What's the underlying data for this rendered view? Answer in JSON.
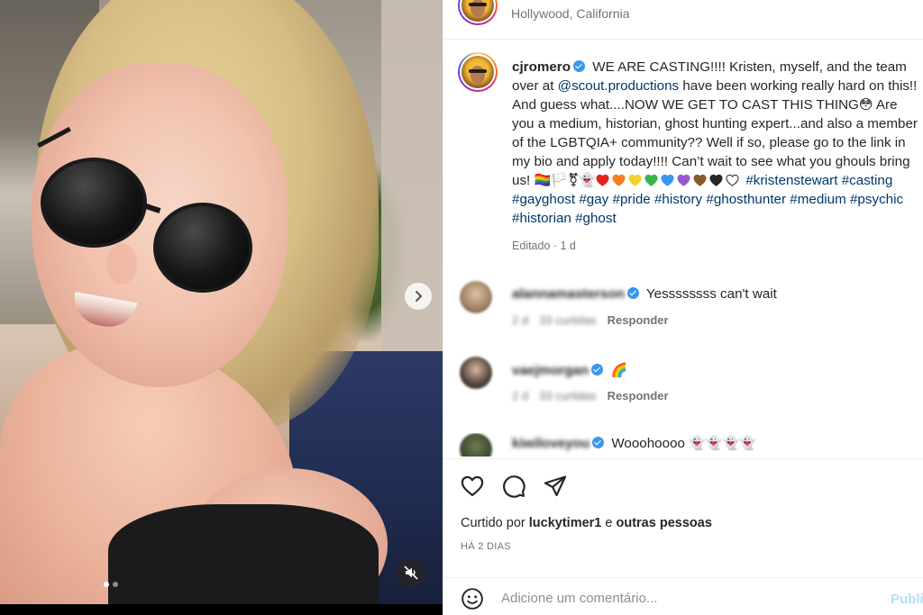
{
  "post": {
    "location": "Hollywood, California",
    "author": "cjromero",
    "caption_parts": {
      "p1": "WE ARE CASTING!!!! Kristen, myself, and the team over at ",
      "mention": "@scout.productions",
      "p2": " have been working really hard on this!! And guess what....NOW WE GET TO CAST THIS THING",
      "emoji1": "😳",
      "p3": " Are you a medium, historian, ghost hunting expert...and also a member of the LGBTQIA+ community?? Well if so, please go to the link in my bio and apply today!!!! Can’t wait to see what you ghouls bring us! ",
      "flags": "🏳️‍🌈🏳️⚧👻",
      "tags": [
        "#kristenstewart",
        "#casting",
        "#gayghost",
        "#gay",
        "#pride",
        "#history",
        "#ghosthunter",
        "#medium",
        "#psychic",
        "#historian",
        "#ghost"
      ]
    },
    "edited": "Editado · 1 d"
  },
  "heart_colors": [
    "#e2231a",
    "#f47f24",
    "#f5d22b",
    "#3cb44b",
    "#3897f0",
    "#9b59d0",
    "#8b5a2b",
    "#262626",
    "#ffffff"
  ],
  "comments": [
    {
      "user": "alannamasterson",
      "text": "Yessssssss can't wait",
      "age": "2 d",
      "likes": "33 curtidas",
      "reply": "Responder"
    },
    {
      "user": "vaejmorgan",
      "text": "🌈",
      "age": "2 d",
      "likes": "33 curtidas",
      "reply": "Responder"
    },
    {
      "user": "kiwiloveyou",
      "text": "Wooohoooo",
      "emoji": "👻👻👻👻"
    }
  ],
  "likes": {
    "prefix": "Curtido por ",
    "user": "luckytimer1",
    "mid": " e ",
    "others": "outras pessoas"
  },
  "time": "HÁ 2 DIAS",
  "add_comment": {
    "placeholder": "Adicione um comentário...",
    "publish": "Publi"
  },
  "icons": {
    "like": "heart-icon",
    "comment": "comment-icon",
    "share": "paper-plane-icon",
    "emoji": "smiley-icon",
    "mute": "speaker-muted-icon",
    "next": "chevron-right-icon"
  }
}
